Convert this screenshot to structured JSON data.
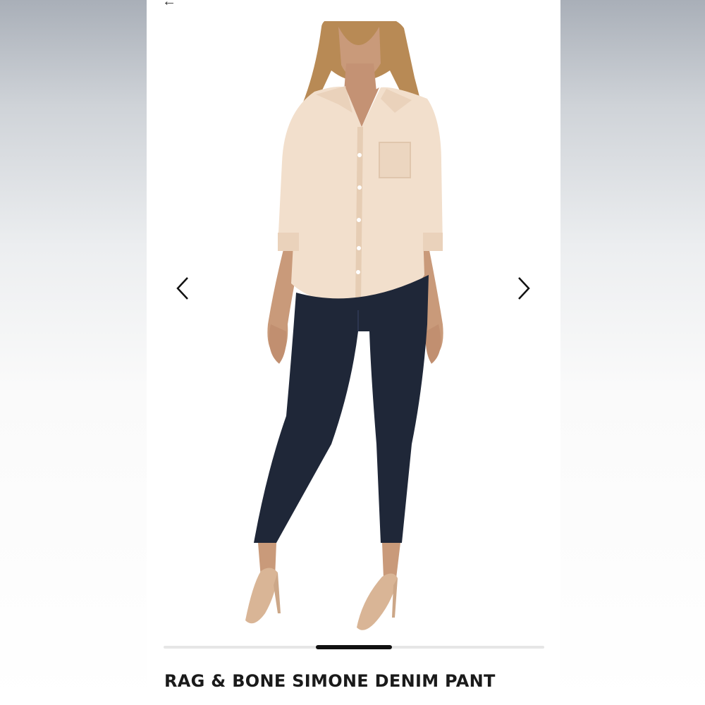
{
  "header": {
    "back_icon": "arrow-left-icon",
    "back_glyph": "←"
  },
  "carousel": {
    "prev_icon": "chevron-left-icon",
    "next_icon": "chevron-right-icon",
    "progress_fraction_start": 0.4,
    "progress_fraction_end": 0.6
  },
  "product": {
    "title": "RAG & BONE SIMONE DENIM PANT",
    "photo_description_icon": "product-photo",
    "colors": {
      "blouse": "#f2dfcc",
      "denim": "#1f2738",
      "skin": "#c99a7a",
      "shoes": "#d9b596",
      "hair": "#b88a55"
    }
  }
}
